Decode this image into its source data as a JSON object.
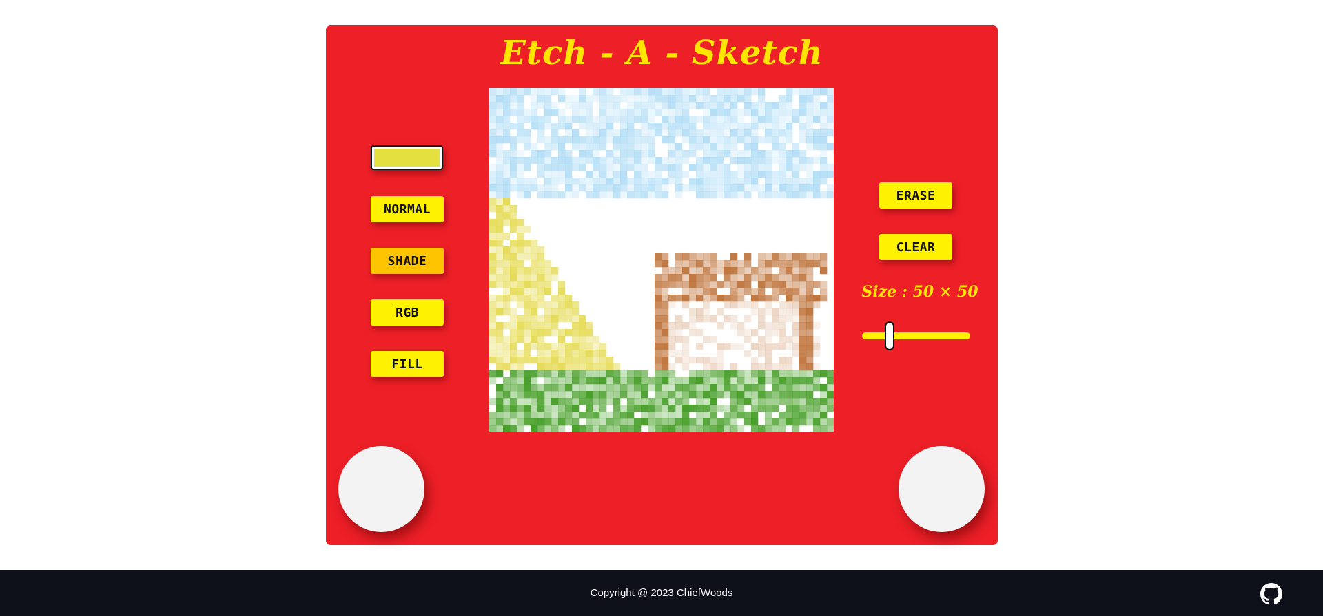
{
  "app": {
    "title": "Etch - A - Sketch"
  },
  "controls": {
    "color_value": "#e3e03f",
    "modes": [
      {
        "label": "NORMAL",
        "active": false
      },
      {
        "label": "SHADE",
        "active": true
      },
      {
        "label": "RGB",
        "active": false
      },
      {
        "label": "FILL",
        "active": false
      }
    ],
    "erase_label": "ERASE",
    "clear_label": "CLEAR",
    "size_label": "Size : 50 × 50",
    "grid_size": 50,
    "grid_min": 1,
    "grid_max": 100
  },
  "colors": {
    "frame": "#ed1f27",
    "title": "#ffe600",
    "button": "#fff200",
    "button_active": "#ffc400",
    "footer": "#0e1119",
    "sky": "#8ecdf0",
    "tree": "#e3d848",
    "house": "#b8682b",
    "grass": "#3f9a1f"
  },
  "footer": {
    "copyright": "Copyright @ 2023 ChiefWoods",
    "icon": "github-icon"
  }
}
